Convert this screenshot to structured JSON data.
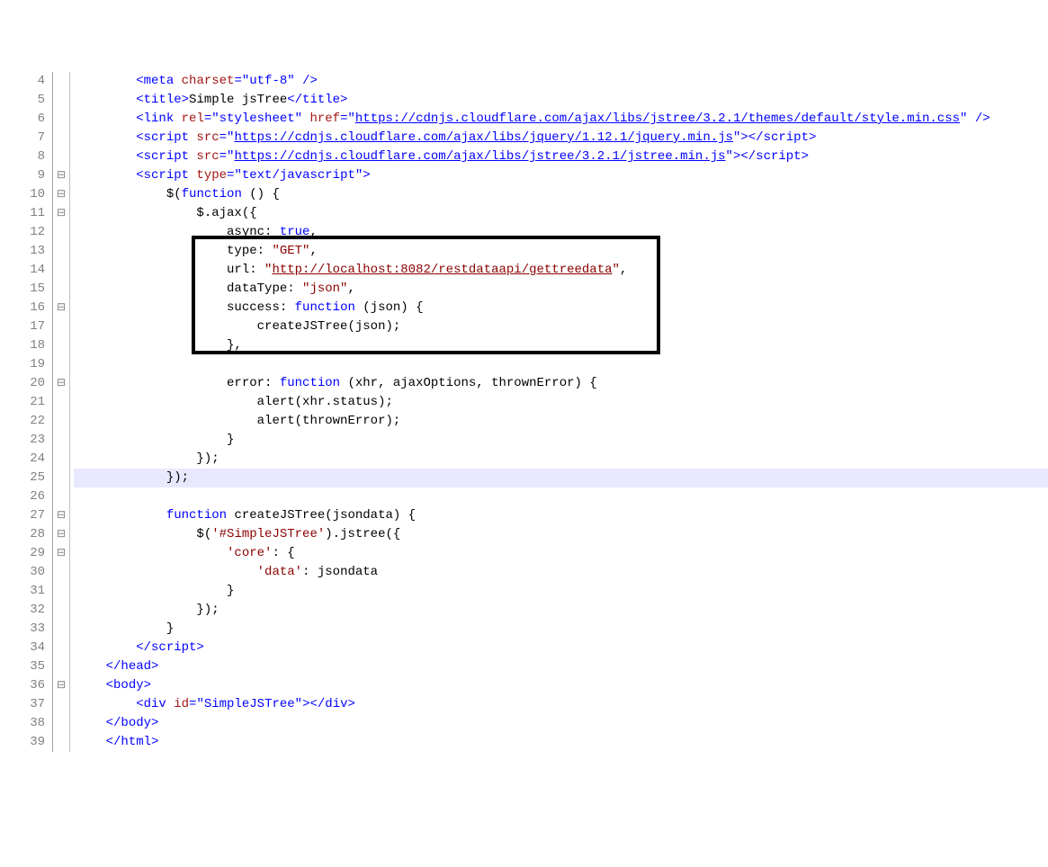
{
  "lines": {
    "l4": {
      "num": "4",
      "fold": "",
      "change": false
    },
    "l5": {
      "num": "5",
      "fold": "",
      "change": false
    },
    "l6": {
      "num": "6",
      "fold": "",
      "change": false
    },
    "l7": {
      "num": "7",
      "fold": "",
      "change": false
    },
    "l8": {
      "num": "8",
      "fold": "",
      "change": false
    },
    "l9": {
      "num": "9",
      "fold": "⊟",
      "change": false
    },
    "l10": {
      "num": "10",
      "fold": "⊟",
      "change": false
    },
    "l11": {
      "num": "11",
      "fold": "⊟",
      "change": false
    },
    "l12": {
      "num": "12",
      "fold": "",
      "change": false
    },
    "l13": {
      "num": "13",
      "fold": "",
      "change": false
    },
    "l14": {
      "num": "14",
      "fold": "",
      "change": false
    },
    "l15": {
      "num": "15",
      "fold": "",
      "change": false
    },
    "l16": {
      "num": "16",
      "fold": "⊟",
      "change": false
    },
    "l17": {
      "num": "17",
      "fold": "",
      "change": false
    },
    "l18": {
      "num": "18",
      "fold": "",
      "change": false
    },
    "l19": {
      "num": "19",
      "fold": "",
      "change": false
    },
    "l20": {
      "num": "20",
      "fold": "⊟",
      "change": false
    },
    "l21": {
      "num": "21",
      "fold": "",
      "change": false
    },
    "l22": {
      "num": "22",
      "fold": "",
      "change": false
    },
    "l23": {
      "num": "23",
      "fold": "",
      "change": false
    },
    "l24": {
      "num": "24",
      "fold": "",
      "change": false
    },
    "l25": {
      "num": "25",
      "fold": "",
      "change": true
    },
    "l26": {
      "num": "26",
      "fold": "",
      "change": false
    },
    "l27": {
      "num": "27",
      "fold": "⊟",
      "change": false
    },
    "l28": {
      "num": "28",
      "fold": "⊟",
      "change": false
    },
    "l29": {
      "num": "29",
      "fold": "⊟",
      "change": false
    },
    "l30": {
      "num": "30",
      "fold": "",
      "change": false
    },
    "l31": {
      "num": "31",
      "fold": "",
      "change": false
    },
    "l32": {
      "num": "32",
      "fold": "",
      "change": false
    },
    "l33": {
      "num": "33",
      "fold": "",
      "change": false
    },
    "l34": {
      "num": "34",
      "fold": "",
      "change": false
    },
    "l35": {
      "num": "35",
      "fold": "",
      "change": false
    },
    "l36": {
      "num": "36",
      "fold": "⊟",
      "change": false
    },
    "l37": {
      "num": "37",
      "fold": "",
      "change": false
    },
    "l38": {
      "num": "38",
      "fold": "",
      "change": false
    },
    "l39": {
      "num": "39",
      "fold": "",
      "change": false
    }
  },
  "tokens": {
    "meta_open": "<meta",
    "charset_attr": " charset",
    "eq": "=",
    "utf8": "\"utf-8\"",
    "self_close": " />",
    "title_open": "<title>",
    "title_text": "Simple jsTree",
    "title_close": "</title>",
    "link_open": "<link",
    "rel_attr": " rel",
    "rel_val": "\"stylesheet\"",
    "href_attr": " href",
    "href_css": "\"",
    "href_css_url": "https://cdnjs.cloudflare.com/ajax/libs/jstree/3.2.1/themes/default/style.min.css",
    "href_css_end": "\"",
    "script_open": "<script",
    "src_attr": " src",
    "src_jq_open": "\"",
    "src_jq_url": "https://cdnjs.cloudflare.com/ajax/libs/jquery/1.12.1/jquery.min.js",
    "src_jq_close": "\"",
    "script_close_tag": ">",
    "script_end": "</script>",
    "src_jt_url": "https://cdnjs.cloudflare.com/ajax/libs/jstree/3.2.1/jstree.min.js",
    "type_attr": " type",
    "type_val": "\"text/javascript\"",
    "indent1": "        ",
    "indent2": "            ",
    "indent3": "                ",
    "indent4": "                    ",
    "indent5": "                        ",
    "dollar_open": "$(",
    "function_kw": "function",
    "space_paren": " () {",
    "dollar_ajax": "$.ajax({",
    "async_key": "async: ",
    "true_kw": "true",
    "comma": ",",
    "type_key": "type: ",
    "get_str": "\"GET\"",
    "url_key": "url: ",
    "url_q_open": "\"",
    "url_val": "http://localhost:8082/restdataapi/gettreedata",
    "url_q_close": "\"",
    "dataType_key": "dataType: ",
    "json_str": "\"json\"",
    "success_key": "success: ",
    "json_param": " (json) {",
    "createJSTree_call": "createJSTree(json);",
    "close_brace_comma": "},",
    "error_key": "error: ",
    "xhr_params": " (xhr, ajaxOptions, thrownError) {",
    "alert_status": "alert(xhr.status);",
    "alert_thrown": "alert(thrownError);",
    "close_brace": "}",
    "close_paren_brace": "});",
    "func_create": " createJSTree(jsondata) {",
    "jq_selector_open": "$(",
    "tree_sel": "'#SimpleJSTree'",
    "jstree_call": ").jstree({",
    "core_key": "'core'",
    "colon_brace": ": {",
    "data_key": "'data'",
    "colon_jsondata": ": jsondata",
    "script_end2": "</script>",
    "head_close": "</head>",
    "body_open": "<body>",
    "div_open": "<div",
    "id_attr": " id",
    "id_val": "\"SimpleJSTree\"",
    "div_close_tag": ">",
    "div_end": "</div>",
    "body_close": "</body>",
    "html_close": "</html>"
  }
}
